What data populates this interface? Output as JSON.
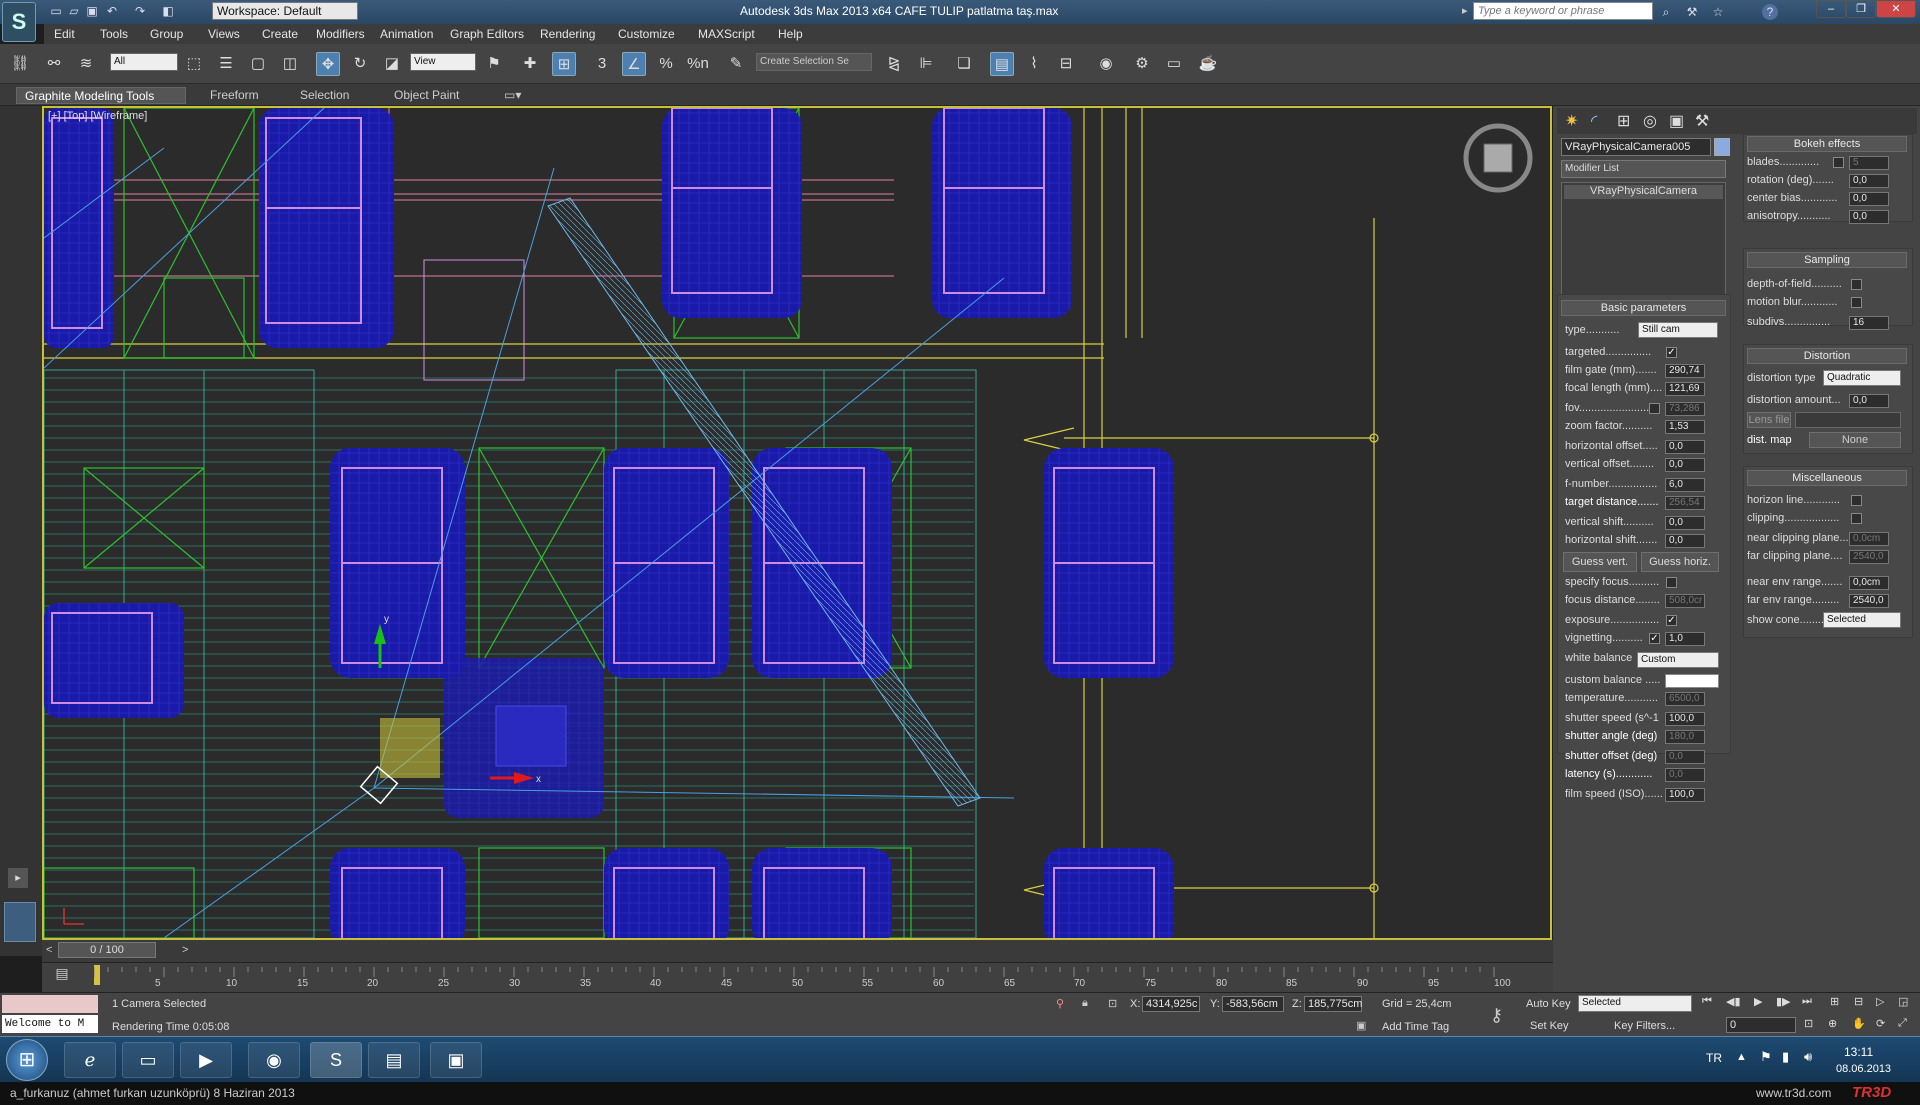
{
  "title": {
    "workspace": "Workspace: Default",
    "app_title": "Autodesk 3ds Max 2013 x64   CAFE TULIP patlatma taş.max",
    "search_placeholder": "Type a keyword or phrase",
    "help_icon": "?"
  },
  "menu": [
    "Edit",
    "Tools",
    "Group",
    "Views",
    "Create",
    "Modifiers",
    "Animation",
    "Graph Editors",
    "Rendering",
    "Customize",
    "MAXScript",
    "Help"
  ],
  "toolbar": {
    "selection_filter": "All",
    "ref_coord": "View",
    "named_selection": "Create Selection Se",
    "snap_3": "3",
    "angle_snap": "%",
    "percent": "%n"
  },
  "ribbon": {
    "tabs": [
      "Graphite Modeling Tools",
      "Freeform",
      "Selection",
      "Object Paint"
    ]
  },
  "viewport": {
    "label": "[+] [Top] [Wireframe]",
    "axis_y": "y",
    "axis_x": "x",
    "colors": {
      "border": "#c8c03a",
      "chairs": "#1a1aa8",
      "chair_outline": "#d08ae0",
      "grid_teal": "#3ac4a8",
      "lines_blue": "#4aa0e0",
      "yellow": "#d8d040",
      "green": "#2ec02e",
      "camera_beam": "#6fb8e8"
    }
  },
  "command_panel": {
    "object_name": "VRayPhysicalCamera005",
    "modifier_list": "Modifier List",
    "stack_item": "VRayPhysicalCamera",
    "basic": {
      "header": "Basic parameters",
      "type_label": "type...........",
      "type_value": "Still cam",
      "targeted": "targeted...............",
      "film_gate": "film gate (mm).......",
      "film_gate_v": "290,74",
      "focal": "focal length (mm)....",
      "focal_v": "121,69",
      "fov": "fov.........................",
      "fov_v": "73,286",
      "zoom": "zoom factor..........",
      "zoom_v": "1,53",
      "hoff": "horizontal offset.....",
      "hoff_v": "0,0",
      "voff": "vertical offset........",
      "voff_v": "0,0",
      "fnum": "f-number................",
      "fnum_v": "6,0",
      "tdist": "target distance.......",
      "tdist_v": "256,54",
      "vshift": "vertical shift..........",
      "vshift_v": "0,0",
      "hshift": "horizontal shift.......",
      "hshift_v": "0,0",
      "guess_vert": "Guess vert.",
      "guess_horiz": "Guess horiz.",
      "specify_focus": "specify focus..........",
      "focus_dist": "focus distance........",
      "focus_dist_v": "508,0cr",
      "exposure": "exposure................",
      "vignetting": "vignetting..........",
      "vignetting_v": "1,0",
      "white_balance": "white balance",
      "white_balance_v": "Custom",
      "custom_balance": "custom balance .....",
      "temperature": "temperature...........",
      "temperature_v": "6500,0",
      "shutter_speed": "shutter speed (s^-1",
      "shutter_speed_v": "100,0",
      "shutter_angle": "shutter angle (deg)",
      "shutter_angle_v": "180,0",
      "shutter_offset": "shutter offset (deg)",
      "shutter_offset_v": "0,0",
      "latency": "latency (s)............",
      "latency_v": "0,0",
      "film_speed": "film speed (ISO)......",
      "film_speed_v": "100,0"
    },
    "bokeh": {
      "header": "Bokeh effects",
      "blades": "blades.............",
      "blades_v": "5",
      "rotation": "rotation (deg).......",
      "rotation_v": "0,0",
      "center_bias": "center bias............",
      "center_bias_v": "0,0",
      "anisotropy": "anisotropy...........",
      "anisotropy_v": "0,0"
    },
    "sampling": {
      "header": "Sampling",
      "dof": "depth-of-field..........",
      "motion_blur": "motion blur............",
      "subdivs": "subdivs...............",
      "subdivs_v": "16"
    },
    "distortion": {
      "header": "Distortion",
      "type": "distortion type",
      "type_v": "Quadratic",
      "amount": "distortion amount...",
      "amount_v": "0,0",
      "lens_file": "Lens file",
      "dist_map": "dist. map",
      "dist_map_v": "None"
    },
    "misc": {
      "header": "Miscellaneous",
      "horizon": "horizon line............",
      "clipping": "clipping..................",
      "near_clip": "near clipping plane...",
      "near_clip_v": "0,0cm",
      "far_clip": "far clipping plane....",
      "far_clip_v": "2540,0",
      "near_env": "near env range.......",
      "near_env_v": "0,0cm",
      "far_env": "far env range.........",
      "far_env_v": "2540,0",
      "show_cone": "show cone..........",
      "show_cone_v": "Selected"
    }
  },
  "timeline": {
    "frame": "0 / 100",
    "ticks": [
      "5",
      "10",
      "15",
      "20",
      "25",
      "30",
      "35",
      "40",
      "45",
      "50",
      "55",
      "60",
      "65",
      "70",
      "75",
      "80",
      "85",
      "90",
      "95",
      "100"
    ]
  },
  "status": {
    "listener": "Welcome to M",
    "selection": "1 Camera Selected",
    "render_time": "Rendering Time  0:05:08",
    "x_label": "X:",
    "x": "4314,925c",
    "y_label": "Y:",
    "y": "-583,56cm",
    "z_label": "Z:",
    "z": "185,775cm",
    "grid": "Grid = 25,4cm",
    "add_time_tag": "Add Time Tag",
    "auto_key": "Auto Key",
    "auto_key_v": "Selected",
    "set_key": "Set Key",
    "key_filters": "Key Filters...",
    "frame_field": "0"
  },
  "taskbar": {
    "lang": "TR",
    "time": "13:11",
    "date": "08.06.2013"
  },
  "caption": {
    "left": "a_furkanuz (ahmet furkan uzunköprü)  8 Haziran 2013",
    "right": "www.tr3d.com",
    "logo": "TR3D"
  }
}
